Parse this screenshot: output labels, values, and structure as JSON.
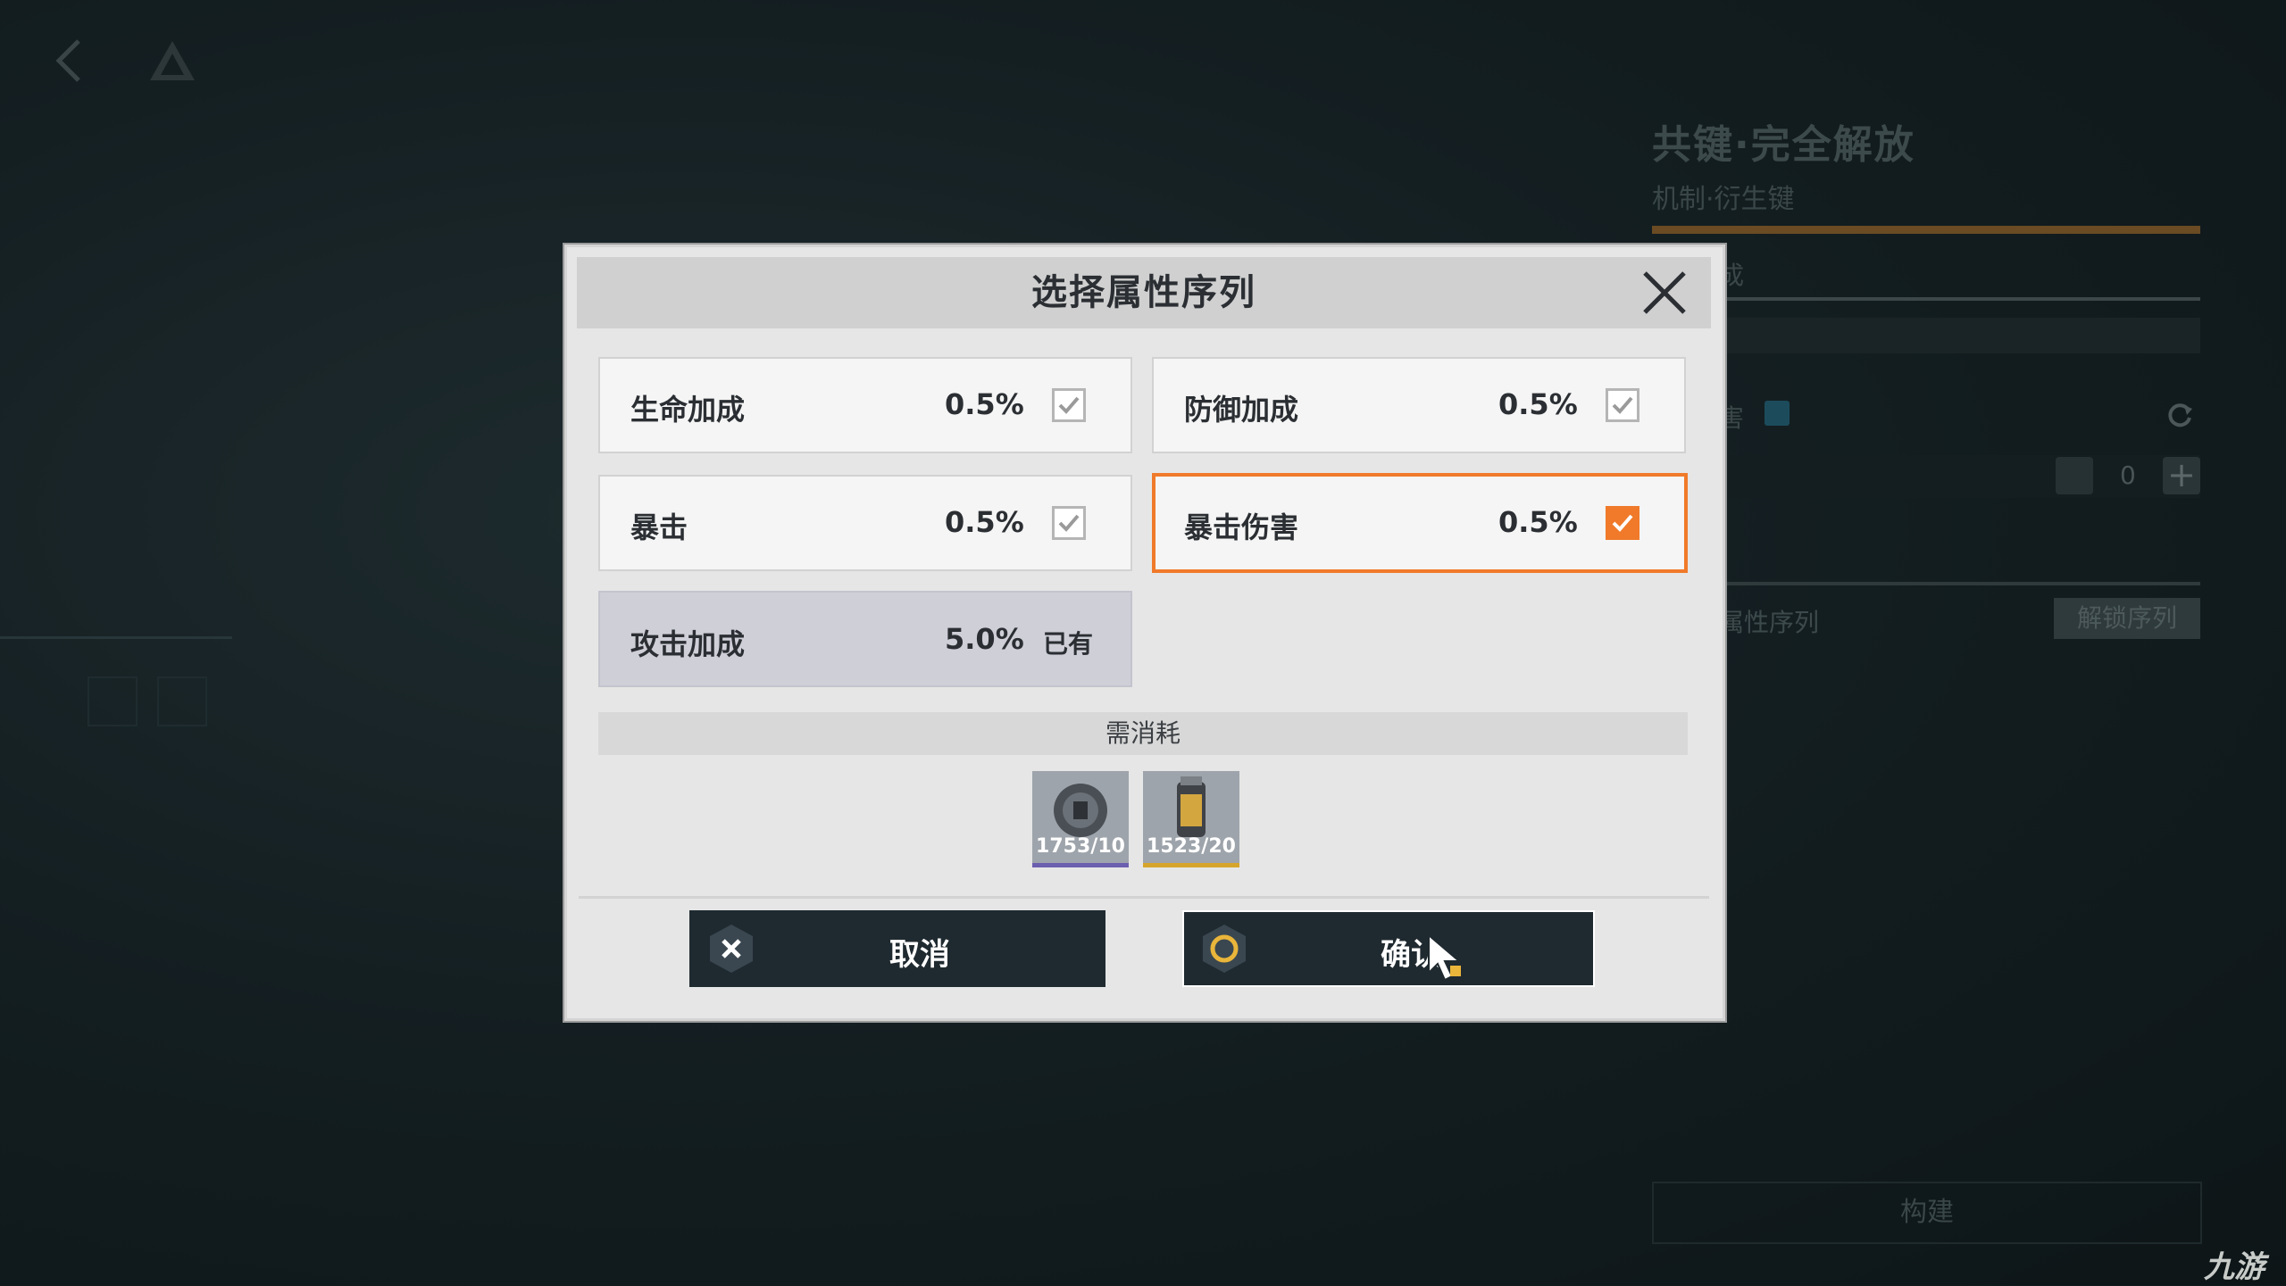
{
  "background": {
    "title": "共键·完全解放",
    "subtitle": "机制·衍生键",
    "bonus_fragment": "成",
    "harm_fragment": "害",
    "counter_value": "0",
    "sequence_fragment": "属性序列",
    "unlock_button": "解锁序列",
    "build_button": "构建",
    "watermark": "九游",
    "plus_symbol": "+"
  },
  "dialog": {
    "title": "选择属性序列",
    "options": [
      {
        "label": "生命加成",
        "value": "0.5%",
        "checked": true,
        "selected": false
      },
      {
        "label": "防御加成",
        "value": "0.5%",
        "checked": true,
        "selected": false
      },
      {
        "label": "暴击",
        "value": "0.5%",
        "checked": true,
        "selected": false
      },
      {
        "label": "暴击伤害",
        "value": "0.5%",
        "checked": true,
        "selected": true
      }
    ],
    "owned": {
      "label": "攻击加成",
      "value": "5.0%",
      "tag": "已有"
    },
    "cost_label": "需消耗",
    "items": [
      {
        "icon": "coin-icon",
        "count": "1753/10",
        "rarity_color": "#6b5fb0"
      },
      {
        "icon": "canister-icon",
        "count": "1523/20",
        "rarity_color": "#d6a52b"
      }
    ],
    "cancel_label": "取消",
    "confirm_label": "确认"
  },
  "colors": {
    "accent": "#f07a2a",
    "dialog_bg": "#e6e6e6",
    "button_bg": "#1f2a30"
  }
}
